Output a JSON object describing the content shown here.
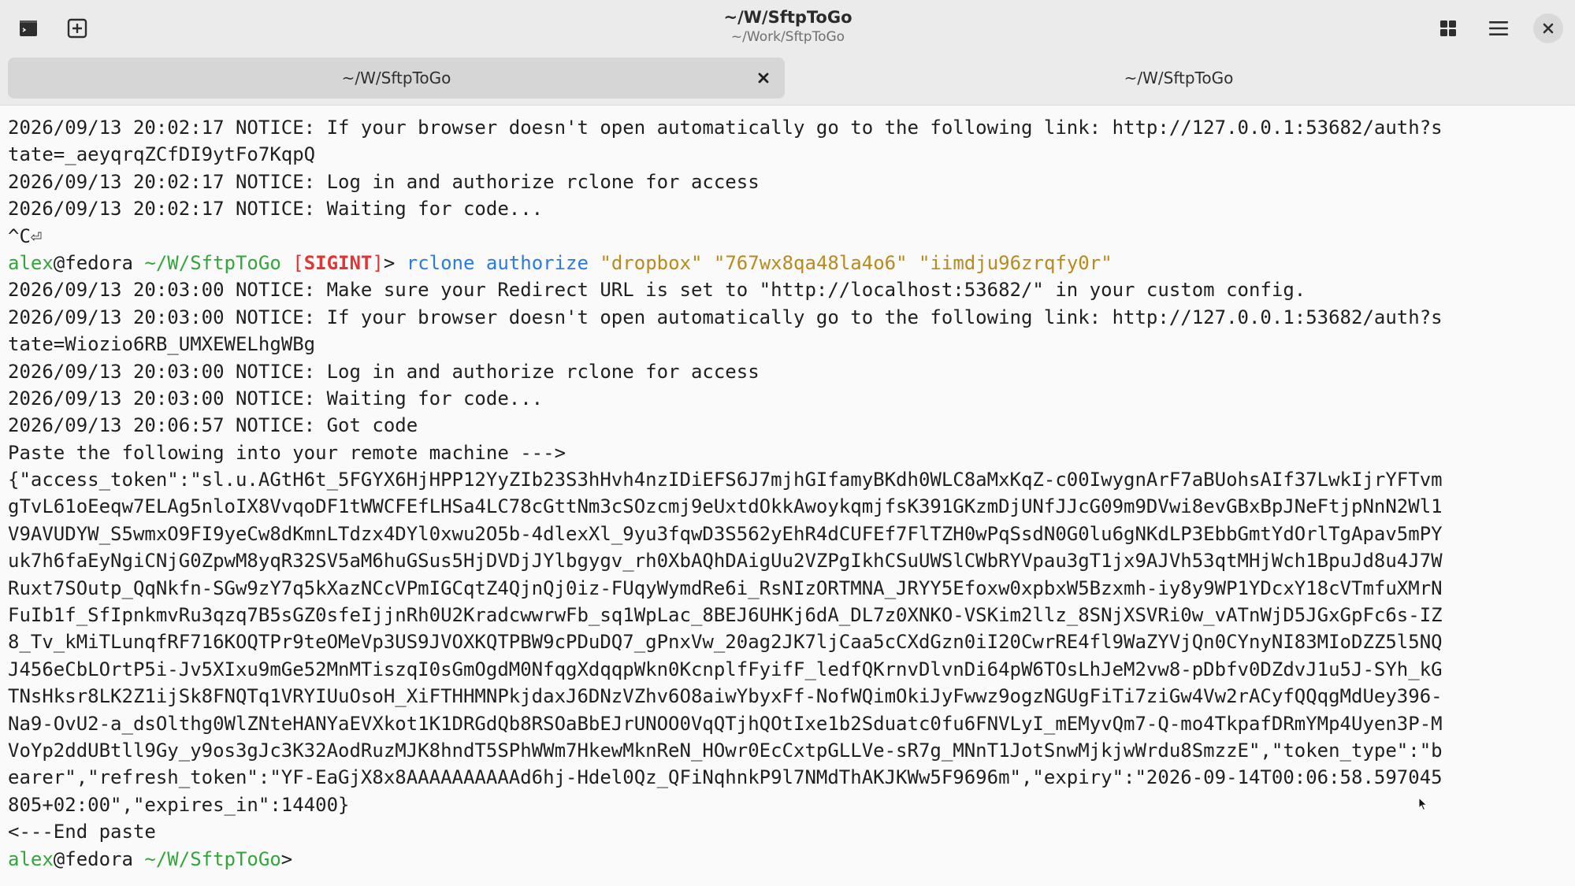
{
  "window": {
    "title": "~/W/SftpToGo",
    "subtitle": "~/Work/SftpToGo"
  },
  "icons": {
    "terminal": "terminal-icon",
    "new_tab": "new-tab-icon",
    "grid": "grid-icon",
    "menu": "hamburger-menu-icon",
    "close": "close-icon"
  },
  "tabs": [
    {
      "label": "~/W/SftpToGo",
      "active": true
    },
    {
      "label": "~/W/SftpToGo",
      "active": false
    }
  ],
  "colors": {
    "prompt_user": "#33a63b",
    "prompt_path": "#33a63b",
    "signal": "#e23434",
    "command": "#2a7bde",
    "string_arg": "#b88a1f"
  },
  "terminal": {
    "lines": [
      "2026/09/13 20:02:17 NOTICE: If your browser doesn't open automatically go to the following link: http://127.0.0.1:53682/auth?s",
      "tate=_aeyqrqZCfDI9ytFo7KqpQ",
      "2026/09/13 20:02:17 NOTICE: Log in and authorize rclone for access",
      "2026/09/13 20:02:17 NOTICE: Waiting for code...",
      "^C⏎",
      "2026/09/13 20:03:00 NOTICE: Make sure your Redirect URL is set to \"http://localhost:53682/\" in your custom config.",
      "2026/09/13 20:03:00 NOTICE: If your browser doesn't open automatically go to the following link: http://127.0.0.1:53682/auth?s",
      "tate=Wiozio6RB_UMXEWELhgWBg",
      "2026/09/13 20:03:00 NOTICE: Log in and authorize rclone for access",
      "2026/09/13 20:03:00 NOTICE: Waiting for code...",
      "2026/09/13 20:06:57 NOTICE: Got code",
      "Paste the following into your remote machine --->",
      "{\"access_token\":\"sl.u.AGtH6t_5FGYX6HjHPP12YyZIb23S3hHvh4nzIDiEFS6J7mjhGIfamyBKdh0WLC8aMxKqZ-c00IwygnArF7aBUohsAIf37LwkIjrYFTvm",
      "gTvL61oEeqw7ELAg5nloIX8VvqoDF1tWWCFEfLHSa4LC78cGttNm3cSOzcmj9eUxtdOkkAwoykqmjfsK391GKzmDjUNfJJcG09m9DVwi8evGBxBpJNeFtjpNnN2Wl1",
      "V9AVUDYW_S5wmxO9FI9yeCw8dKmnLTdzx4DYl0xwu2O5b-4dlexXl_9yu3fqwD3S562yEhR4dCUFEf7FlTZH0wPqSsdN0G0lu6gNKdLP3EbbGmtYdOrlTgApav5mPY",
      "uk7h6faEyNgiCNjG0ZpwM8yqR32SV5aM6huGSus5HjDVDjJYlbgygv_rh0XbAQhDAigUu2VZPgIkhCSuUWSlCWbRYVpau3gT1jx9AJVh53qtMHjWch1BpuJd8u4J7W",
      "Ruxt7SOutp_QqNkfn-SGw9zY7q5kXazNCcVPmIGCqtZ4QjnQj0iz-FUqyWymdRe6i_RsNIzORTMNA_JRYY5Efoxw0xpbxW5Bzxmh-iy8y9WP1YDcxY18cVTmfuXMrN",
      "FuIb1f_SfIpnkmvRu3qzq7B5sGZ0sfeIjjnRh0U2KradcwwrwFb_sq1WpLac_8BEJ6UHKj6dA_DL7z0XNKO-VSKim2llz_8SNjXSVRi0w_vATnWjD5JGxGpFc6s-IZ",
      "8_Tv_kMiTLunqfRF716KOQTPr9teOMeVp3US9JVOXKQTPBW9cPDuDQ7_gPnxVw_20ag2JK7ljCaa5cCXdGzn0iI20CwrRE4fl9WaZYVjQn0CYnyNI83MIoDZZ5l5NQ",
      "J456eCbLOrtP5i-Jv5XIxu9mGe52MnMTiszqI0sGmOgdM0NfqgXdqqpWkn0KcnplfFyifF_ledfQKrnvDlvnDi64pW6TOsLhJeM2vw8-pDbfv0DZdvJ1u5J-SYh_kG",
      "TNsHksr8LK2Z1ijSk8FNQTq1VRYIUuOsoH_XiFTHHMNPkjdaxJ6DNzVZhv6O8aiwYbyxFf-NofWQimOkiJyFwwz9ogzNGUgFiTi7ziGw4Vw2rACyfQQqgMdUey396-",
      "Na9-OvU2-a_dsOlthg0WlZNteHANYaEVXkot1K1DRGdQb8RSOaBbEJrUNOO0VqQTjhQOtIxe1b2Sduatc0fu6FNVLyI_mEMyvQm7-Q-mo4TkpafDRmYMp4Uyen3P-M",
      "VoYp2ddUBtll9Gy_y9os3gJc3K32AodRuzMJK8hndT5SPhWWm7HkewMknReN_HOwr0EcCxtpGLLVe-sR7g_MNnT1JotSnwMjkjwWrdu8SmzzE\",\"token_type\":\"b",
      "earer\",\"refresh_token\":\"YF-EaGjX8x8AAAAAAAAAAd6hj-Hdel0Qz_QFiNqhnkP9l7NMdThAKJKWw5F9696m\",\"expiry\":\"2026-09-14T00:06:58.597045",
      "805+02:00\",\"expires_in\":14400}",
      "<---End paste"
    ],
    "prompt1": {
      "user": "alex",
      "at_host": "@fedora ",
      "path": "~/W/SftpToGo",
      "sig_open": " [",
      "signal": "SIGINT",
      "sig_close": "]",
      "arrow": "> ",
      "cmd": "rclone",
      "sub": "authorize",
      "arg1": "\"dropbox\"",
      "arg2": "\"767wx8qa48la4o6\"",
      "arg3": "\"iimdju96zrqfy0r\""
    },
    "prompt2": {
      "user": "alex",
      "at_host": "@fedora ",
      "path": "~/W/SftpToGo",
      "arrow": ">"
    }
  }
}
